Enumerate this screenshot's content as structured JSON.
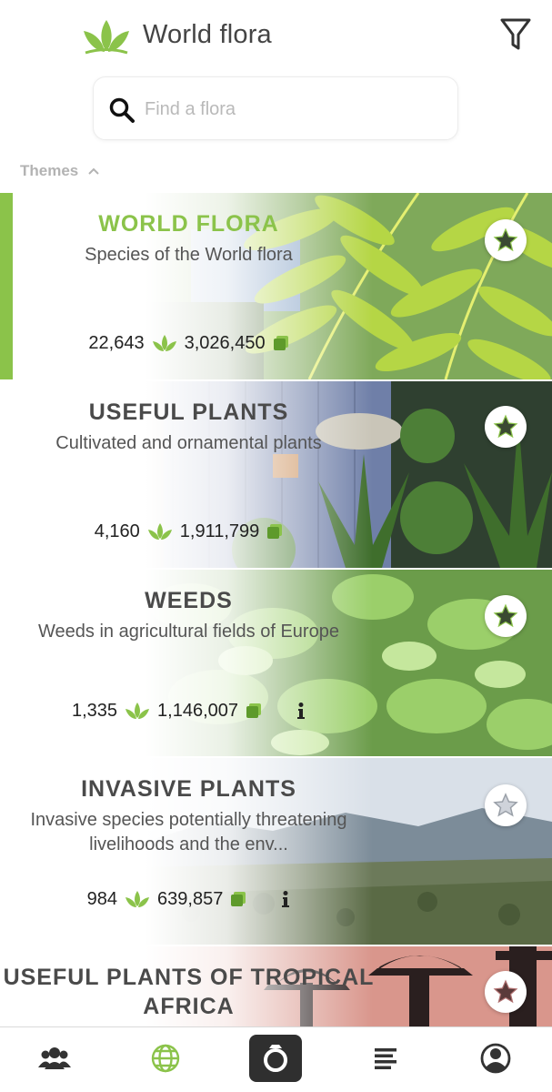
{
  "header": {
    "title": "World flora",
    "logo_icon": "leaf-logo-icon",
    "filter_icon": "filter-icon"
  },
  "search": {
    "placeholder": "Find a flora",
    "value": ""
  },
  "themes": {
    "label": "Themes",
    "expanded": true
  },
  "colors": {
    "accent": "#8bc34a",
    "text": "#444444",
    "nav_icon": "#333333"
  },
  "floras": [
    {
      "title": "WORLD FLORA",
      "description": "Species of the World flora",
      "species_count": "22,643",
      "observation_count": "3,026,450",
      "selected": true,
      "favorite": true,
      "has_info": false
    },
    {
      "title": "USEFUL PLANTS",
      "description": "Cultivated and ornamental plants",
      "species_count": "4,160",
      "observation_count": "1,911,799",
      "selected": false,
      "favorite": true,
      "has_info": false
    },
    {
      "title": "WEEDS",
      "description": "Weeds in agricultural fields of Europe",
      "species_count": "1,335",
      "observation_count": "1,146,007",
      "selected": false,
      "favorite": true,
      "has_info": true
    },
    {
      "title": "INVASIVE PLANTS",
      "description": "Invasive species potentially threatening livelihoods and the env...",
      "species_count": "984",
      "observation_count": "639,857",
      "selected": false,
      "favorite": false,
      "has_info": true
    },
    {
      "title": "USEFUL PLANTS OF TROPICAL AFRICA",
      "description": "",
      "species_count": "",
      "observation_count": "",
      "selected": false,
      "favorite": true,
      "has_info": false
    }
  ],
  "bottom_nav": {
    "items": [
      "community-icon",
      "globe-icon",
      "camera-icon",
      "list-icon",
      "profile-icon"
    ],
    "active": "globe-icon"
  }
}
